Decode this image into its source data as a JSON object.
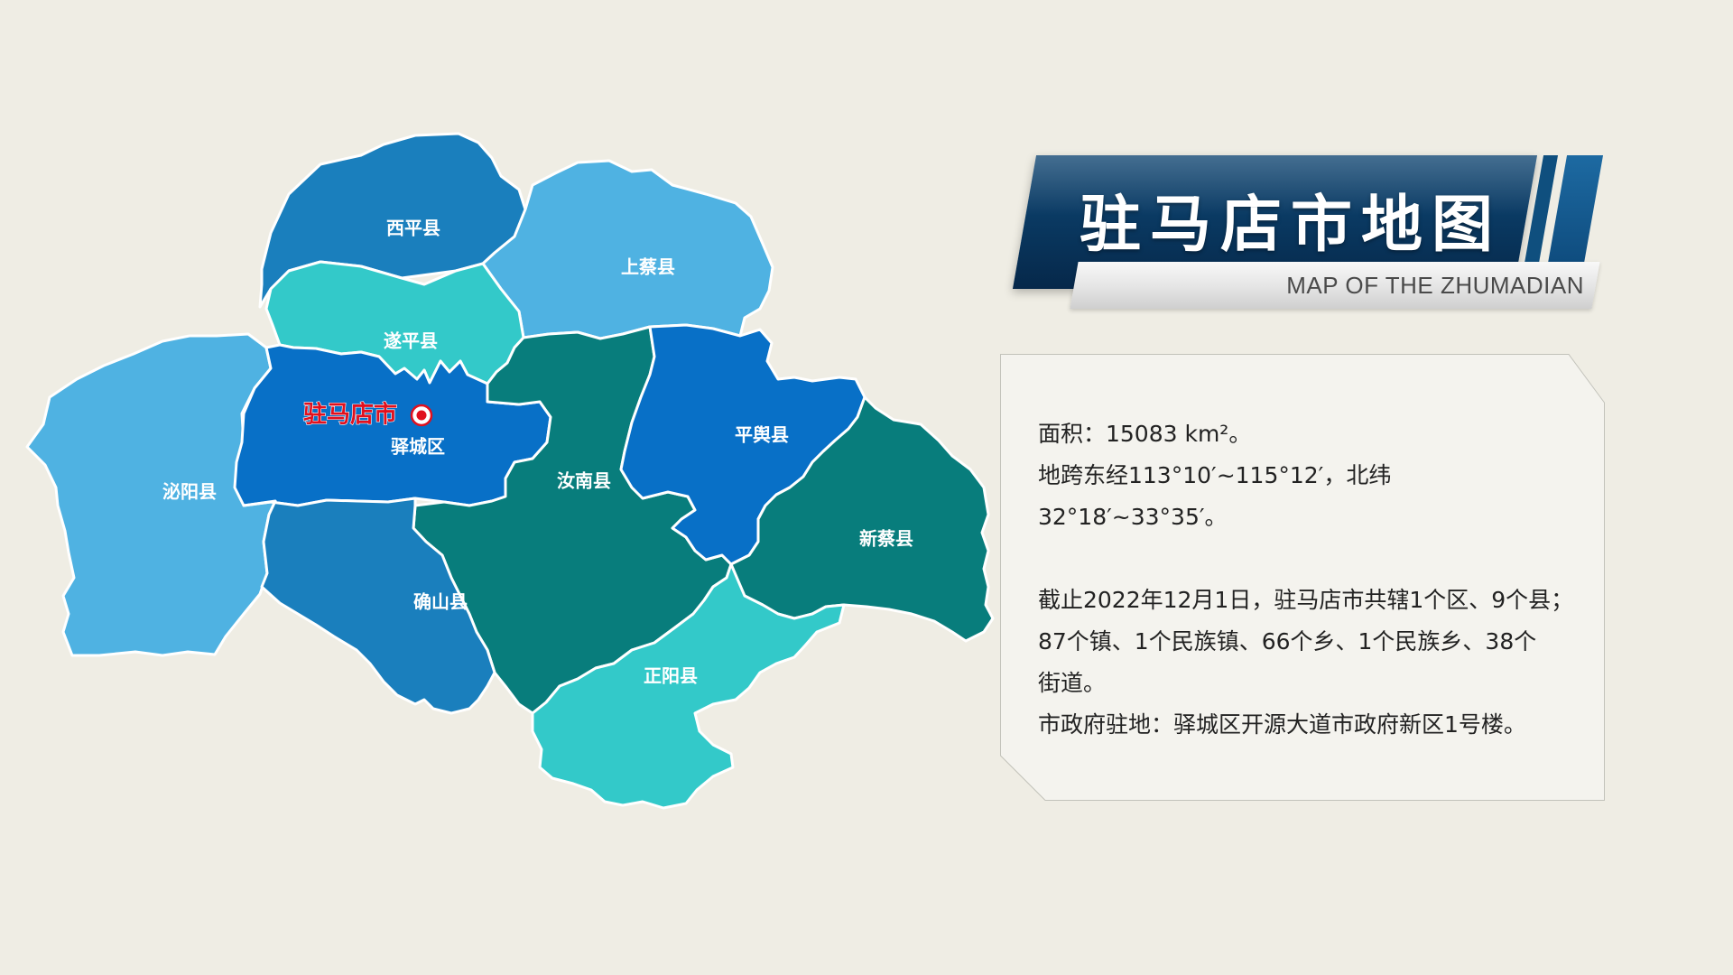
{
  "map": {
    "regions": [
      {
        "id": "xiping",
        "name": "西平县",
        "color": "#1a7fbd"
      },
      {
        "id": "shangcai",
        "name": "上蔡县",
        "color": "#4fb2e2"
      },
      {
        "id": "suiping",
        "name": "遂平县",
        "color": "#33c9c9"
      },
      {
        "id": "biyang",
        "name": "泌阳县",
        "color": "#4fb2e2"
      },
      {
        "id": "yicheng",
        "name": "驿城区",
        "color": "#0870c7"
      },
      {
        "id": "runan",
        "name": "汝南县",
        "color": "#087d7c"
      },
      {
        "id": "pingyu",
        "name": "平舆县",
        "color": "#0870c7"
      },
      {
        "id": "xincai",
        "name": "新蔡县",
        "color": "#087d7c"
      },
      {
        "id": "queshan",
        "name": "确山县",
        "color": "#1a7fbd"
      },
      {
        "id": "zhengyang",
        "name": "正阳县",
        "color": "#33c9c9"
      }
    ],
    "city_marker": {
      "name": "驻马店市",
      "icon": "city-marker-icon",
      "color": "#e0101e"
    }
  },
  "title": {
    "main": "驻马店市地图",
    "subtitle": "MAP OF THE ZHUMADIAN"
  },
  "info": {
    "area": "面积：15083 km²。",
    "coords": "地跨东经113°10′~115°12′，北纬32°18′~33°35′。",
    "admin_line1": "截止2022年12月1日，驻马店市共辖1个区、9个县；",
    "admin_line2": "87个镇、1个民族镇、66个乡、1个民族乡、38个",
    "admin_line3": "街道。",
    "government": "市政府驻地：驿城区开源大道市政府新区1号楼。"
  }
}
